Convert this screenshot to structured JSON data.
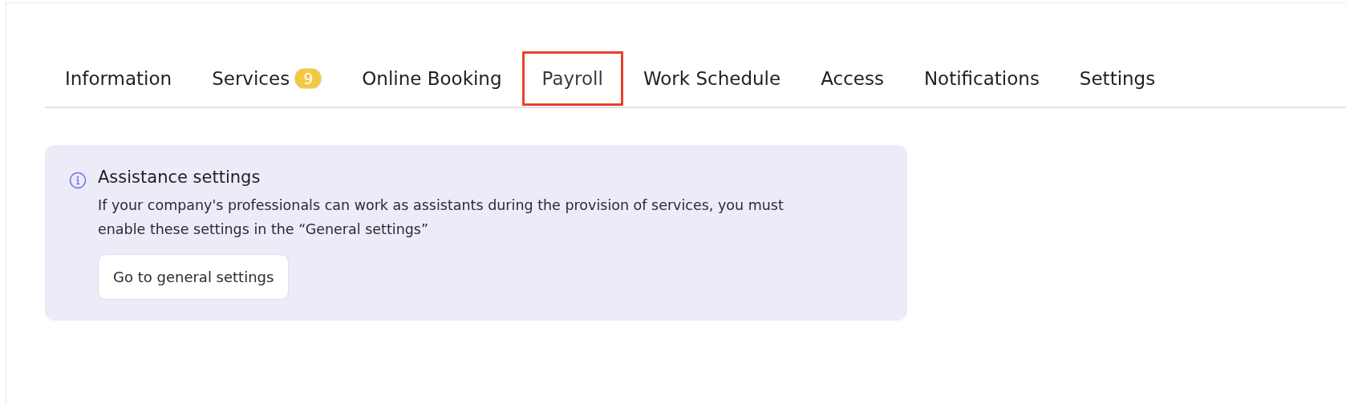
{
  "tabs": [
    {
      "label": "Information",
      "selected": false
    },
    {
      "label": "Services",
      "selected": false,
      "badge": "9"
    },
    {
      "label": "Online Booking",
      "selected": false
    },
    {
      "label": "Payroll",
      "selected": true
    },
    {
      "label": "Work Schedule",
      "selected": false
    },
    {
      "label": "Access",
      "selected": false
    },
    {
      "label": "Notifications",
      "selected": false
    },
    {
      "label": "Settings",
      "selected": false
    }
  ],
  "notice": {
    "title": "Assistance settings",
    "text": "If your company's professionals can work as assistants during the provision of services, you must enable these settings in the “General settings”",
    "button": "Go to general settings"
  }
}
